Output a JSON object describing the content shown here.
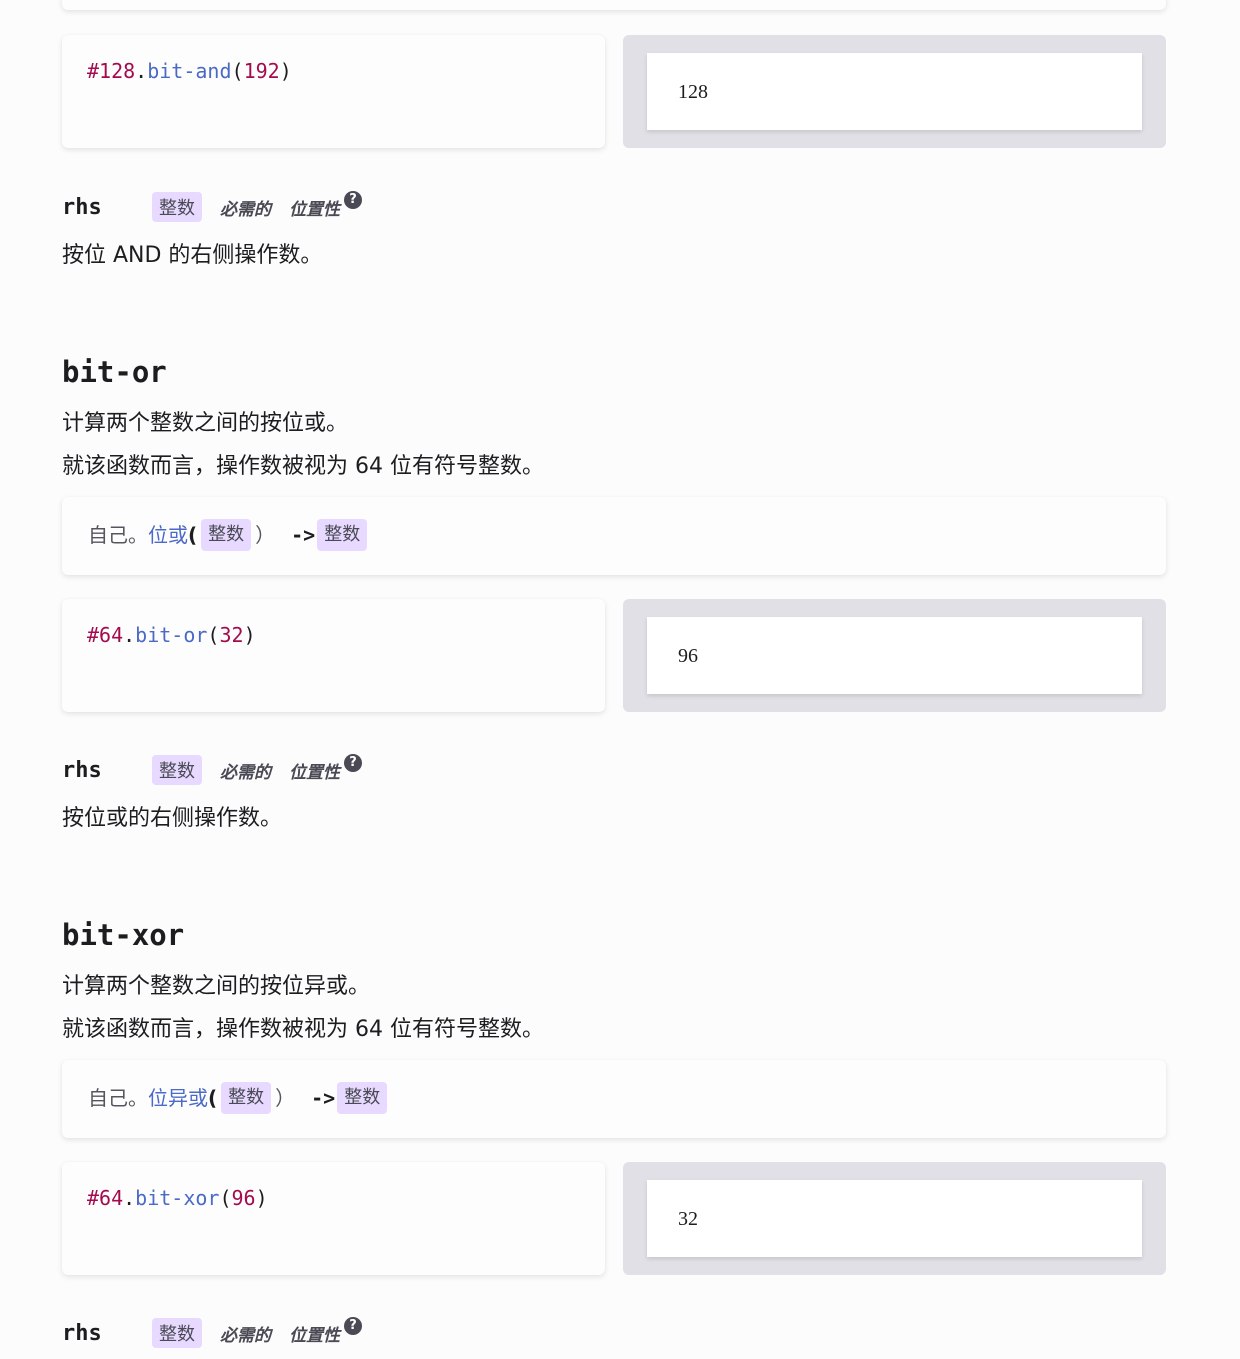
{
  "sections": [
    {
      "example": {
        "receiver": "#128",
        "dot": ".",
        "method": "bit-and",
        "open_paren": "(",
        "arg": "192",
        "close_paren": ")",
        "result": "128"
      },
      "param": {
        "name": "rhs",
        "type": "整数",
        "required": "必需的",
        "positional": "位置性",
        "help": "?",
        "description": "按位 AND 的右侧操作数。"
      }
    },
    {
      "title": "bit-or",
      "description": [
        "计算两个整数之间的按位或。",
        "就该函数而言，操作数被视为 64 位有符号整数。"
      ],
      "signature": {
        "self": "自己。",
        "fn": "位或",
        "open_paren": "(",
        "arg_type": "整数",
        "close_paren": "）",
        "arrow": "->",
        "return_type": "整数"
      },
      "example": {
        "receiver": "#64",
        "dot": ".",
        "method": "bit-or",
        "open_paren": "(",
        "arg": "32",
        "close_paren": ")",
        "result": "96"
      },
      "param": {
        "name": "rhs",
        "type": "整数",
        "required": "必需的",
        "positional": "位置性",
        "help": "?",
        "description": "按位或的右侧操作数。"
      }
    },
    {
      "title": "bit-xor",
      "description": [
        "计算两个整数之间的按位异或。",
        "就该函数而言，操作数被视为 64 位有符号整数。"
      ],
      "signature": {
        "self": "自己。",
        "fn": "位异或",
        "open_paren": "(",
        "arg_type": "整数",
        "close_paren": "）",
        "arrow": "->",
        "return_type": "整数"
      },
      "example": {
        "receiver": "#64",
        "dot": ".",
        "method": "bit-xor",
        "open_paren": "(",
        "arg": "96",
        "close_paren": ")",
        "result": "32"
      },
      "param": {
        "name": "rhs",
        "type": "整数",
        "required": "必需的",
        "positional": "位置性",
        "help": "?"
      }
    }
  ],
  "colors": {
    "number": "#a50a4f",
    "function": "#4b69c6",
    "type_pill": "#e7d9ff",
    "preview_bg": "#e0e0e6",
    "page_bg": "#fcfcfd"
  }
}
